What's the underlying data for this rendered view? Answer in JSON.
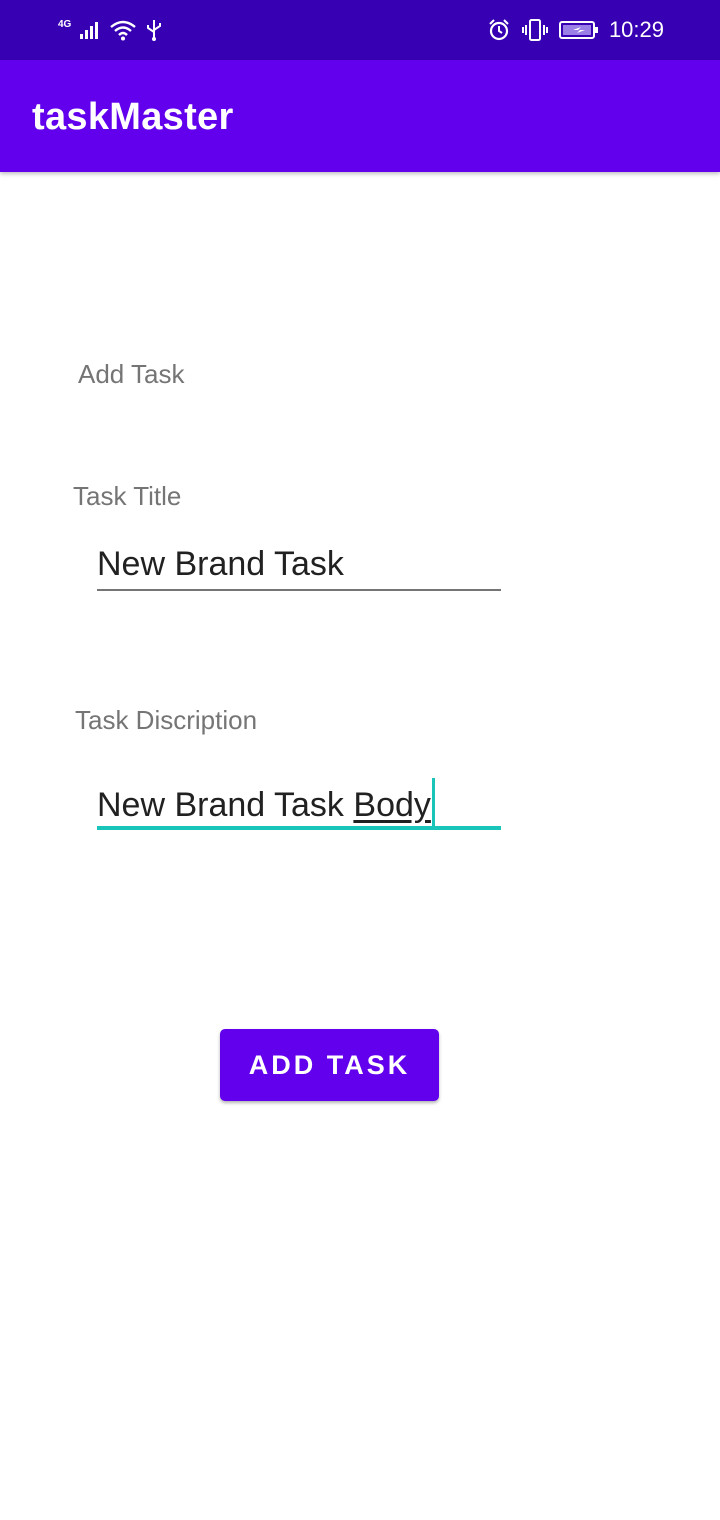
{
  "status_bar": {
    "network_type": "4G",
    "time": "10:29",
    "icons": [
      "signal-icon",
      "wifi-icon",
      "usb-icon",
      "alarm-icon",
      "vibrate-icon",
      "battery-charging-icon"
    ]
  },
  "app_bar": {
    "title": "taskMaster"
  },
  "form": {
    "heading": "Add Task",
    "title_label": "Task Title",
    "title_value": "New Brand Task",
    "description_label": "Task Discription",
    "description_value_prefix": "New Brand Task ",
    "description_value_current_word": "Body",
    "submit_label": "ADD TASK"
  },
  "colors": {
    "status_bar": "#3700b3",
    "primary": "#6200ee",
    "accent": "#18c5b8",
    "label": "#757575",
    "text": "#212121"
  }
}
